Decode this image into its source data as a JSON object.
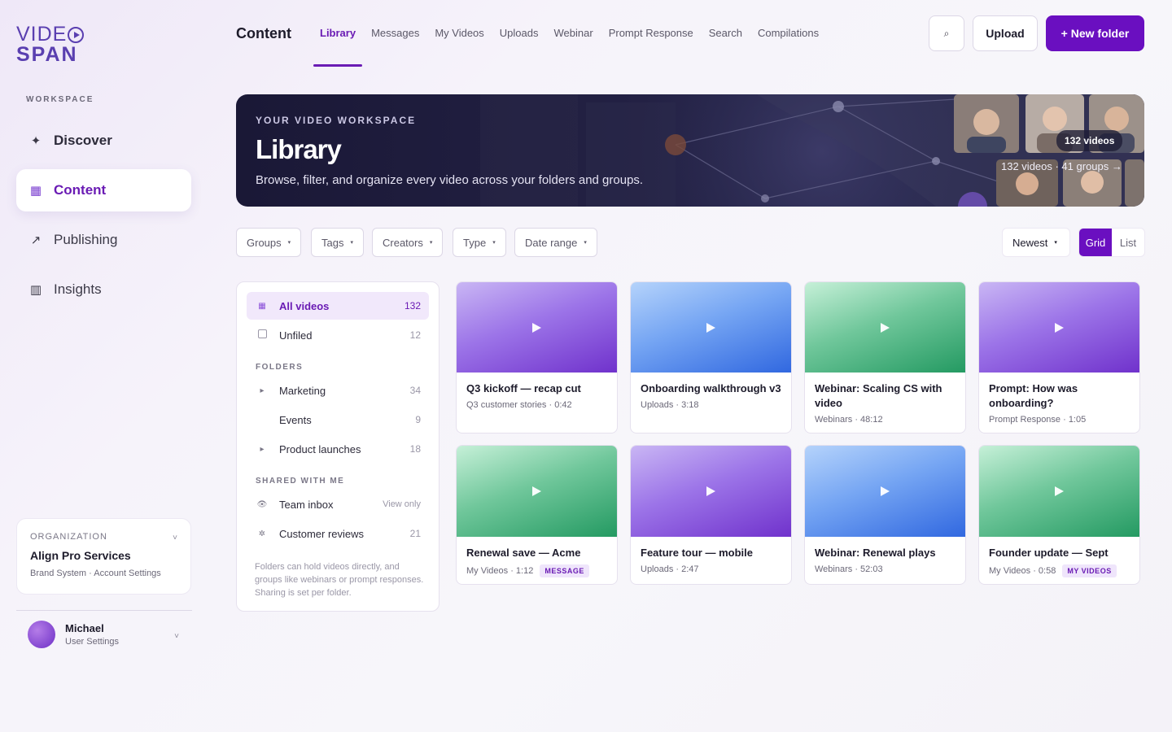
{
  "logo": {
    "top": "VIDE",
    "bottom": "SPAN"
  },
  "sidebar": {
    "section_label": "WORKSPACE",
    "items": [
      {
        "label": "Discover",
        "icon": "sparkle-icon",
        "glyph": "✦"
      },
      {
        "label": "Content",
        "icon": "grid-icon",
        "glyph": "▦"
      },
      {
        "label": "Publishing",
        "icon": "arrow-up-right-icon",
        "glyph": "↗"
      },
      {
        "label": "Insights",
        "icon": "bar-chart-icon",
        "glyph": "▥"
      }
    ],
    "org": {
      "label": "ORGANIZATION",
      "name": "Align Pro Services",
      "links": "Brand System · Account Settings",
      "chevron": "˅"
    },
    "user": {
      "name": "Michael",
      "sub": "User Settings",
      "chevron": "˅"
    }
  },
  "header": {
    "title": "Content",
    "tabs": [
      "Library",
      "Messages",
      "My Videos",
      "Uploads",
      "Webinar",
      "Prompt Response",
      "Search",
      "Compilations"
    ],
    "search_glyph": "⌕",
    "upload_label": "Upload",
    "new_folder_label": "+ New folder"
  },
  "hero": {
    "eyebrow": "YOUR VIDEO WORKSPACE",
    "title": "Library",
    "subtitle": "Browse, filter, and organize every video across your folders and groups.",
    "badge": "132 videos",
    "meta": "132 videos · 41 groups →"
  },
  "filters": [
    "Groups",
    "Tags",
    "Creators",
    "Type",
    "Date range"
  ],
  "caret": "▾",
  "sort": "Newest",
  "view": {
    "grid": "Grid",
    "list": "List"
  },
  "folders_panel": {
    "all": {
      "label": "All videos",
      "count": "132"
    },
    "unfiled": {
      "label": "Unfiled",
      "count": "12"
    },
    "folders_label": "FOLDERS",
    "folders": [
      {
        "label": "Marketing",
        "count": "34",
        "expander": "▸"
      },
      {
        "label": "Events",
        "count": "9",
        "expander": ""
      },
      {
        "label": "Product launches",
        "count": "18",
        "expander": "▸"
      }
    ],
    "shared_label": "SHARED WITH ME",
    "shared": [
      {
        "label": "Team inbox",
        "count": "View only",
        "glyph": "👁"
      },
      {
        "label": "Customer reviews",
        "count": "21",
        "glyph": "✲"
      }
    ],
    "note": "Folders can hold videos directly, and groups like webinars or prompt responses. Sharing is set per folder."
  },
  "videos": [
    {
      "title": "Q3 kickoff — recap cut",
      "meta": "Q3 customer stories · 0:42",
      "tag": "",
      "color": "purple"
    },
    {
      "title": "Onboarding walkthrough v3",
      "meta": "Uploads · 3:18",
      "tag": "",
      "color": "blue"
    },
    {
      "title": "Webinar: Scaling CS with video",
      "meta": "Webinars · 48:12",
      "tag": "",
      "color": "green"
    },
    {
      "title": "Prompt: How was onboarding?",
      "meta": "Prompt Response · 1:05",
      "tag": "",
      "color": "purple"
    },
    {
      "title": "Renewal save — Acme",
      "meta": "My Videos · 1:12",
      "tag": "MESSAGE",
      "color": "green"
    },
    {
      "title": "Feature tour — mobile",
      "meta": "Uploads · 2:47",
      "tag": "",
      "color": "purple"
    },
    {
      "title": "Webinar: Renewal plays",
      "meta": "Webinars · 52:03",
      "tag": "",
      "color": "blue"
    },
    {
      "title": "Founder update — Sept",
      "meta": "My Videos · 0:58",
      "tag": "MY VIDEOS",
      "color": "green"
    }
  ],
  "colors": {
    "accent": "#6a0fc0",
    "accent_text": "#6a1bb4",
    "hero_bg": "#1a1836"
  }
}
